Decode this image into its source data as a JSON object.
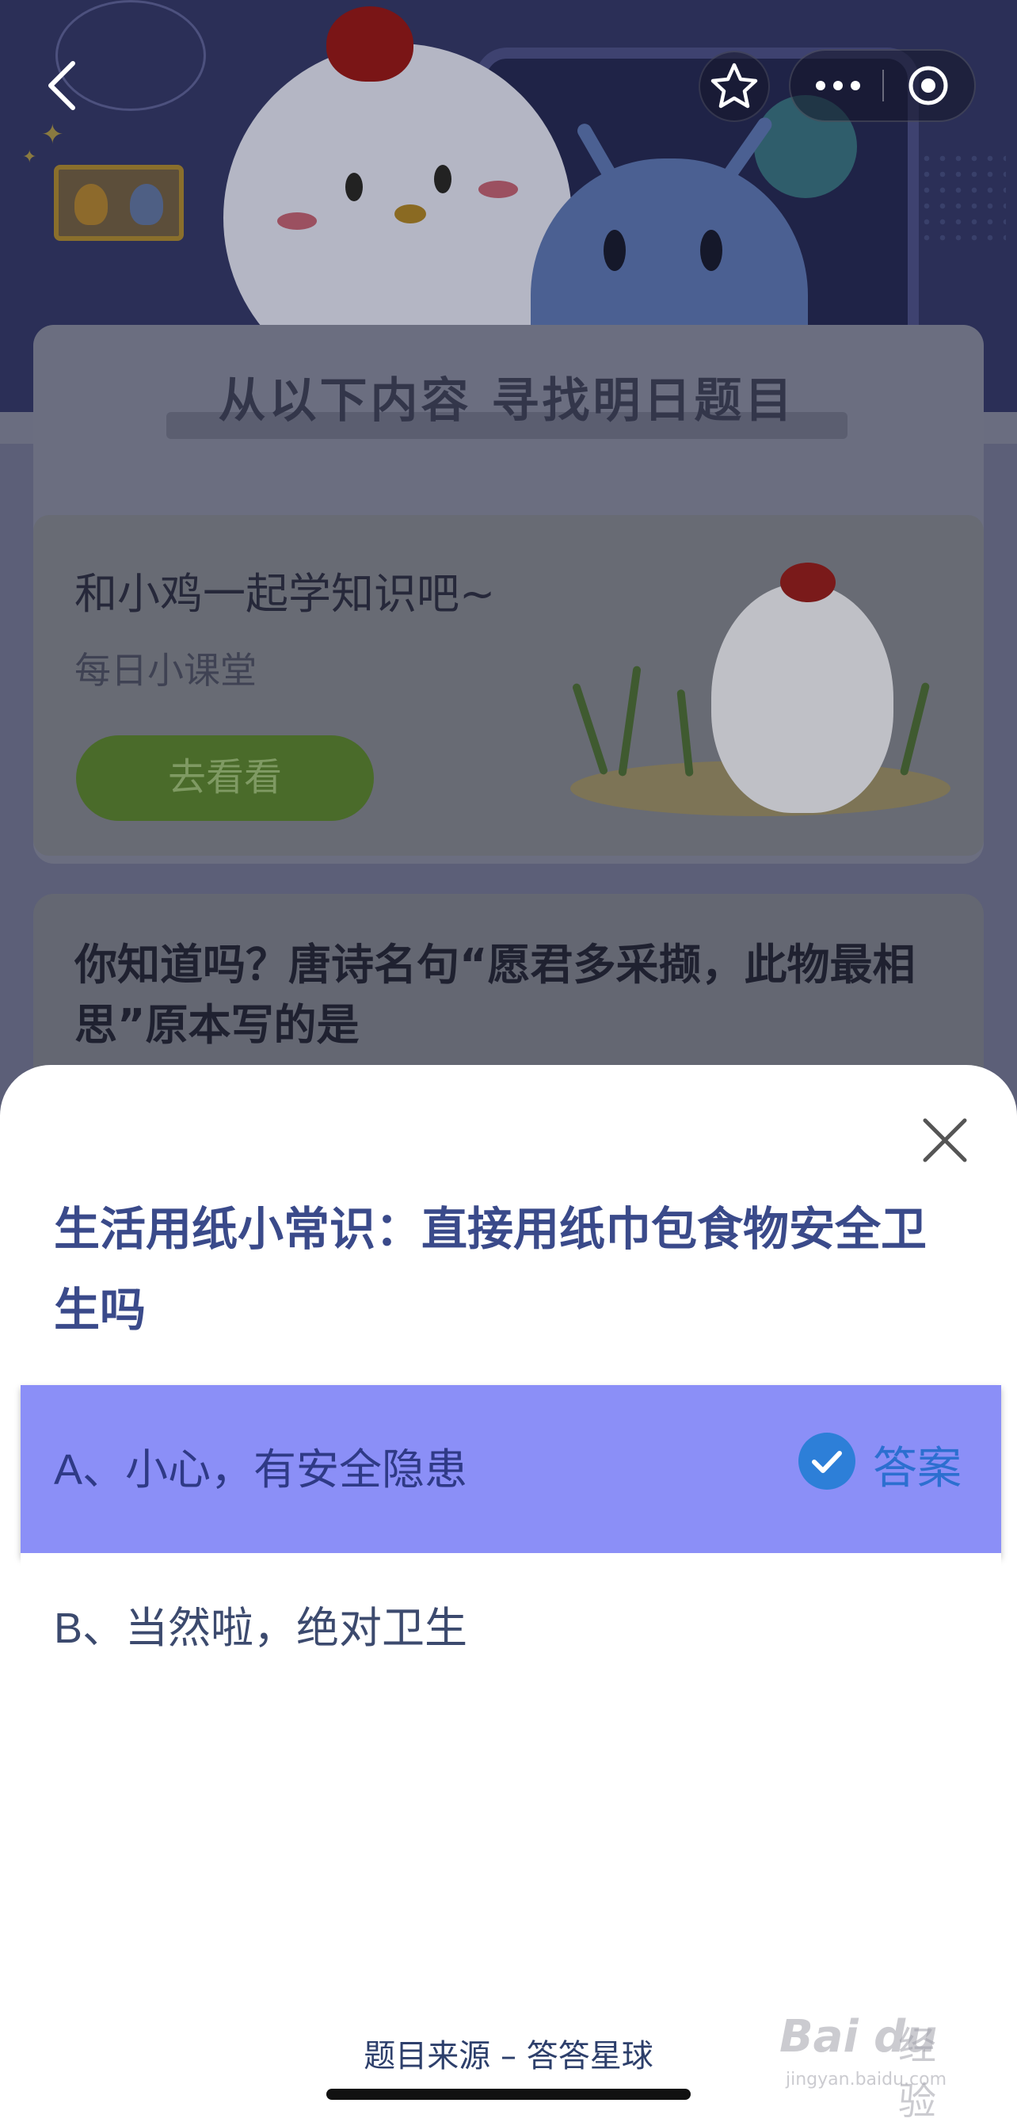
{
  "background": {
    "heading": "从以下内容  寻找明日题目",
    "lesson_card": {
      "title": "和小鸡一起学知识吧~",
      "subtitle": "每日小课堂",
      "button_label": "去看看"
    },
    "quiz_preview": {
      "text": "你知道吗？唐诗名句“愿君多采撷，此物最相思”原本写的是"
    }
  },
  "nav": {
    "back_icon": "chevron-left-icon",
    "favorite_icon": "star-outline-icon",
    "more_icon": "more-dots-icon",
    "close_miniprogram_icon": "target-circle-icon"
  },
  "sheet": {
    "close_icon": "close-x-icon",
    "question": "生活用纸小常识：直接用纸巾包食物安全卫生吗",
    "options": [
      {
        "label": "A、小心，有安全隐患",
        "is_answer": true
      },
      {
        "label": "B、当然啦，绝对卫生",
        "is_answer": false
      }
    ],
    "answer_tag": "答案",
    "source": "题目来源 – 答答星球"
  },
  "watermark": {
    "logo": "Bai du",
    "brand": "经验",
    "url": "jingyan.baidu.com"
  },
  "colors": {
    "highlight": "#8b8ff7",
    "question_text": "#3a4a8a",
    "answer_accent": "#2d7fd8"
  }
}
